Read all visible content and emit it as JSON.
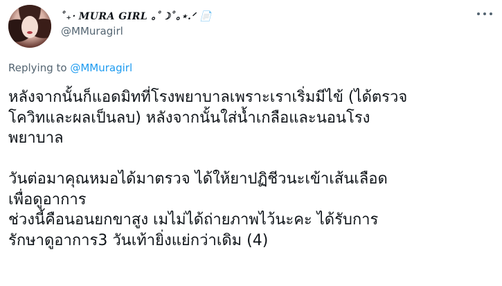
{
  "author": {
    "display_name": "˚₊‧ MURA GIRL ｡˚☽˚｡⋆.ᐟ 📄",
    "handle": "@MMuragirl",
    "avatar_icon": "profile-photo"
  },
  "reply": {
    "prefix": "Replying to ",
    "mention": "@MMuragirl"
  },
  "tweet": {
    "paragraphs": [
      "หลังจากนั้นก็แอดมิทที่โรงพยาบาลเพราะเราเริ่มมีไข้ (ได้ตรวจ\nโควิทและผลเป็นลบ) หลังจากนั้นใส่น้ำเกลือและนอนโรง\nพยาบาล",
      "",
      "วันต่อมาคุณหมอได้มาตรวจ ได้ให้ยาปฏิชีวนะเข้าเส้นเลือด\nเพื่อดูอาการ\nช่วงนี้คือนอนยกขาสูง เมไม่ได้ถ่ายภาพไว้นะคะ ได้รับการ\nรักษาดูอาการ3 วันเท้ายิ่งแย่กว่าเดิม (4)"
    ]
  },
  "colors": {
    "text": "#0f1419",
    "secondary": "#536471",
    "link": "#1d9bf0"
  }
}
